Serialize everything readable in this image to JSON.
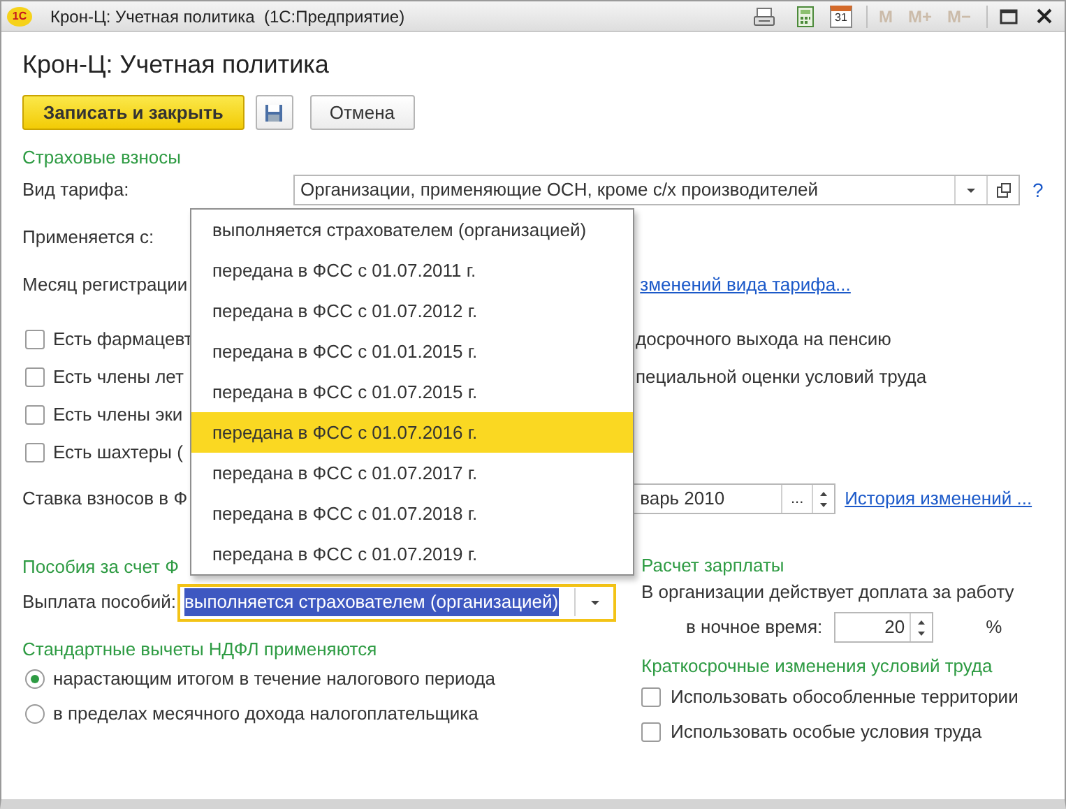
{
  "window": {
    "logo": "1С",
    "title": "Крон-Ц: Учетная политика  (1С:Предприятие)",
    "calendar_day": "31",
    "memory_buttons": [
      {
        "label": "M",
        "disabled": true
      },
      {
        "label": "M+",
        "disabled": true
      },
      {
        "label": "M−",
        "disabled": true
      }
    ]
  },
  "form": {
    "title": "Крон-Ц: Учетная политика"
  },
  "toolbar": {
    "buttons": [
      {
        "kind": "primary",
        "label": "Записать и закрыть"
      },
      {
        "kind": "save"
      },
      {
        "kind": "plain",
        "label": "Отмена"
      }
    ]
  },
  "insurance": {
    "heading": "Страховые взносы",
    "tariff": {
      "label": "Вид тарифа:",
      "value": "Организации, применяющие ОСН, кроме с/х производителей",
      "help": "?"
    },
    "applies_label": "Применяется с:",
    "registration": {
      "label": "Месяц регистрации",
      "link": "зменений вида тарифа..."
    },
    "checkboxes": [
      {
        "label": "Есть фармацевт",
        "right_text": "досрочного выхода на пенсию",
        "checked": false
      },
      {
        "label": "Есть члены лет",
        "right_text": "пециальной оценки условий труда",
        "checked": false
      },
      {
        "label": "Есть члены эки",
        "checked": false
      },
      {
        "label": "Есть шахтеры (",
        "checked": false
      }
    ],
    "rate": {
      "label": "Ставка взносов в Ф",
      "value": "варь 2010",
      "dots": "...",
      "link": "История изменений ..."
    }
  },
  "benefits": {
    "heading": "Пособия за счет Ф",
    "payment": {
      "label": "Выплата пособий:",
      "value": "выполняется страхователем (организацией)",
      "focused": true
    }
  },
  "ndfl": {
    "heading": "Стандартные вычеты НДФЛ применяются",
    "options": [
      {
        "label": "нарастающим итогом в течение налогового периода",
        "selected": true
      },
      {
        "label": "в пределах месячного дохода налогоплательщика",
        "selected": false
      }
    ]
  },
  "payroll": {
    "heading": "Расчет зарплаты",
    "night_label": "В организации действует доплата за работу",
    "night_field_label": "в ночное время:",
    "night_value": "20",
    "unit": "%"
  },
  "short_term": {
    "heading": "Краткосрочные изменения условий труда",
    "checkboxes": [
      {
        "label": "Использовать обособленные территории",
        "checked": false
      },
      {
        "label": "Использовать особые условия труда",
        "checked": false
      }
    ]
  },
  "dropdown": {
    "items": [
      {
        "label": "выполняется страхователем (организацией)",
        "selected": false
      },
      {
        "label": "передана в ФСС с 01.07.2011 г.",
        "selected": false
      },
      {
        "label": "передана в ФСС с 01.07.2012 г.",
        "selected": false
      },
      {
        "label": "передана в ФСС с 01.01.2015 г.",
        "selected": false
      },
      {
        "label": "передана в ФСС с 01.07.2015 г.",
        "selected": false
      },
      {
        "label": "передана в ФСС с 01.07.2016 г.",
        "selected": true
      },
      {
        "label": "передана в ФСС с 01.07.2017 г.",
        "selected": false
      },
      {
        "label": "передана в ФСС с 01.07.2018 г.",
        "selected": false
      },
      {
        "label": "передана в ФСС с 01.07.2019 г.",
        "selected": false
      }
    ]
  }
}
